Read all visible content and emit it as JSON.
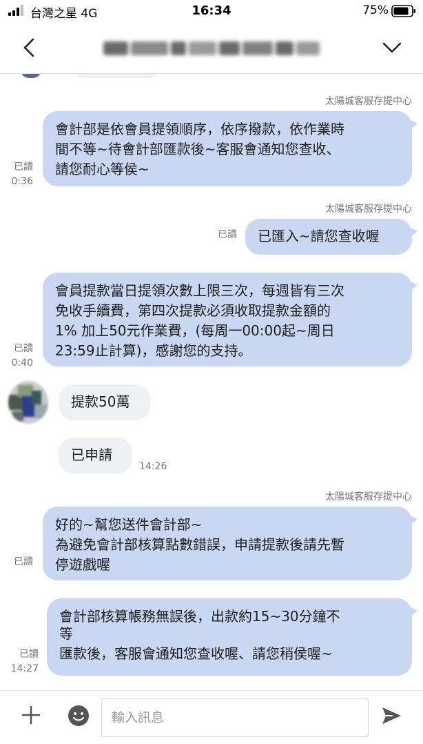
{
  "status_bar": {
    "carrier": "台灣之星 4G",
    "time": "16:34",
    "battery": "75%"
  },
  "header": {
    "back_icon": "chevron-left-icon",
    "title_blurred": true,
    "menu_icon": "chevron-down-icon"
  },
  "messages": [
    {
      "id": 1,
      "direction": "out",
      "sender": "太陽城客服存提中心",
      "lines": [
        "會計部是依會員提領順序，依序撥款，依作業時",
        "間不等~待會計部匯款後~客服會通知您查收、",
        "請您耐心等侯~"
      ],
      "read": "已讀",
      "time": "0:36"
    },
    {
      "id": 2,
      "direction": "out",
      "sender": "太陽城客服存提中心",
      "lines": [
        "已匯入~請您查收喔"
      ],
      "read": "已讀",
      "time": ""
    },
    {
      "id": 3,
      "direction": "out",
      "sender": "",
      "lines": [
        "會員提款當日提領次數上限三次，每週皆有三次",
        "免收手續費，第四次提款必須收取提款金額的",
        "1% 加上50元作業費，(每周一00:00起~周日",
        "23:59止計算)，感謝您的支持。"
      ],
      "read": "已讀",
      "time": "0:40"
    },
    {
      "id": 4,
      "direction": "in",
      "lines": [
        "提款50萬"
      ],
      "time": ""
    },
    {
      "id": 5,
      "direction": "in",
      "lines": [
        "已申請"
      ],
      "time": "14:26"
    },
    {
      "id": 6,
      "direction": "out",
      "sender": "太陽城客服存提中心",
      "lines": [
        "好的~幫您送件會計部~",
        "為避免會計部核算點數錯誤，申請提款後請先暫",
        "停遊戲喔"
      ],
      "read": "已讀",
      "time": ""
    },
    {
      "id": 7,
      "direction": "out",
      "sender": "",
      "lines": [
        "會計部核算帳務無誤後，出款約15~30分鐘不",
        "等",
        "匯款後，客服會通知您查收喔、請您稍侯喔~"
      ],
      "read": "已讀",
      "time": "14:27"
    }
  ],
  "input_bar": {
    "placeholder": "輸入訊息",
    "value": "",
    "plus_icon": "plus-icon",
    "emoji_icon": "emoji-icon",
    "send_icon": "send-icon"
  },
  "colors": {
    "outgoing_bubble": "#c9d7f2",
    "incoming_bubble": "#eef0f3",
    "meta_text": "#777777"
  }
}
